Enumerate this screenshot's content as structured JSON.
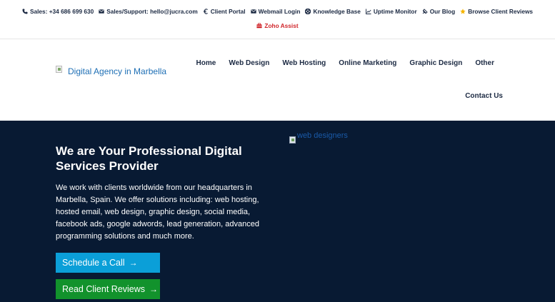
{
  "topbar": {
    "links": [
      {
        "label": "Sales: +34 686 699 630",
        "icon": "phone-icon"
      },
      {
        "label": "Sales/Support: hello@jucra.com",
        "icon": "envelope-icon"
      },
      {
        "label": "Client Portal",
        "icon": "euro-icon"
      },
      {
        "label": "Webmail Login",
        "icon": "envelope-icon"
      },
      {
        "label": "Knowledge Base",
        "icon": "life-ring-icon"
      },
      {
        "label": "Uptime Monitor",
        "icon": "line-chart-icon"
      },
      {
        "label": "Our Blog",
        "icon": "rss-icon"
      },
      {
        "label": "Browse Client Reviews",
        "icon": "star-icon"
      }
    ],
    "zoho": {
      "label": "Zoho Assist",
      "icon": "toolbox-icon"
    }
  },
  "header": {
    "logo_alt": "Digital Agency in Marbella",
    "nav": [
      "Home",
      "Web Design",
      "Web Hosting",
      "Online Marketing",
      "Graphic Design",
      "Other"
    ],
    "nav_second_row": "Contact Us"
  },
  "hero": {
    "title": "We are Your Professional Digital Services Provider",
    "text": "We work with clients worldwide from our headquarters in Marbella, Spain.  We offer solutions including: web hosting, hosted email, web design, graphic design, social media, facebook ads, google adwords, lead generation, advanced programming solutions and much more.",
    "schedule_label": "Schedule a Call",
    "reviews_label": "Read Client Reviews",
    "arrow": "→",
    "image_alt": "web designers"
  },
  "colors": {
    "hero_bg": "#081a33",
    "schedule_btn": "#0b9fd8",
    "reviews_btn": "#12922c",
    "zoho_red": "#d0252a",
    "star": "#f5b400"
  }
}
